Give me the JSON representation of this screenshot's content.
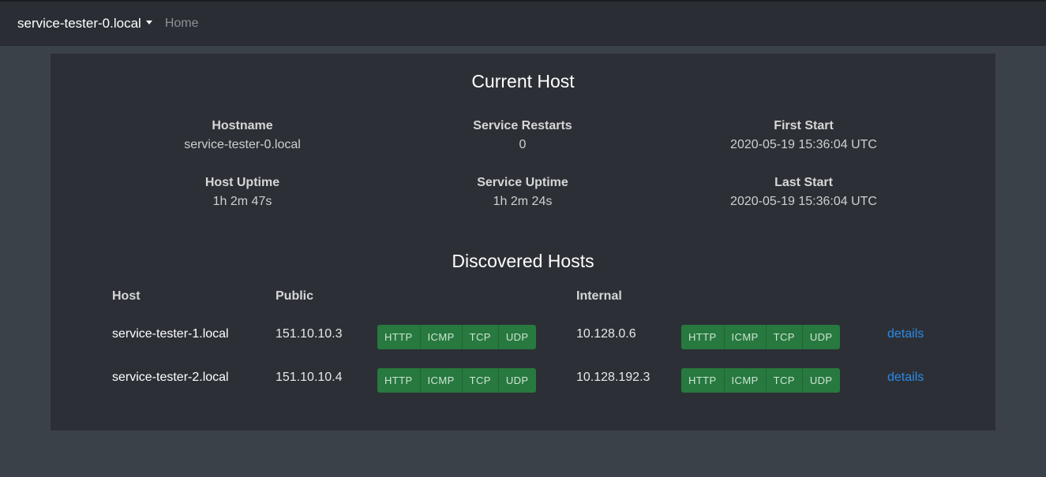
{
  "navbar": {
    "brand": "service-tester-0.local",
    "home": "Home"
  },
  "current_host": {
    "title": "Current Host",
    "stats": [
      {
        "label": "Hostname",
        "value": "service-tester-0.local"
      },
      {
        "label": "Service Restarts",
        "value": "0"
      },
      {
        "label": "First Start",
        "value": "2020-05-19 15:36:04 UTC"
      },
      {
        "label": "Host Uptime",
        "value": "1h 2m 47s"
      },
      {
        "label": "Service Uptime",
        "value": "1h 2m 24s"
      },
      {
        "label": "Last Start",
        "value": "2020-05-19 15:36:04 UTC"
      }
    ]
  },
  "discovered": {
    "title": "Discovered Hosts",
    "headers": {
      "host": "Host",
      "public": "Public",
      "internal": "Internal"
    },
    "protocols": [
      "HTTP",
      "ICMP",
      "TCP",
      "UDP"
    ],
    "rows": [
      {
        "host": "service-tester-1.local",
        "public": "151.10.10.3",
        "internal": "10.128.0.6",
        "link": "details"
      },
      {
        "host": "service-tester-2.local",
        "public": "151.10.10.4",
        "internal": "10.128.192.3",
        "link": "details"
      }
    ]
  },
  "colors": {
    "background": "#3b4148",
    "navbar": "#2a2e34",
    "card": "#2c3036",
    "success": "#27793f",
    "link": "#2b8ae8"
  }
}
